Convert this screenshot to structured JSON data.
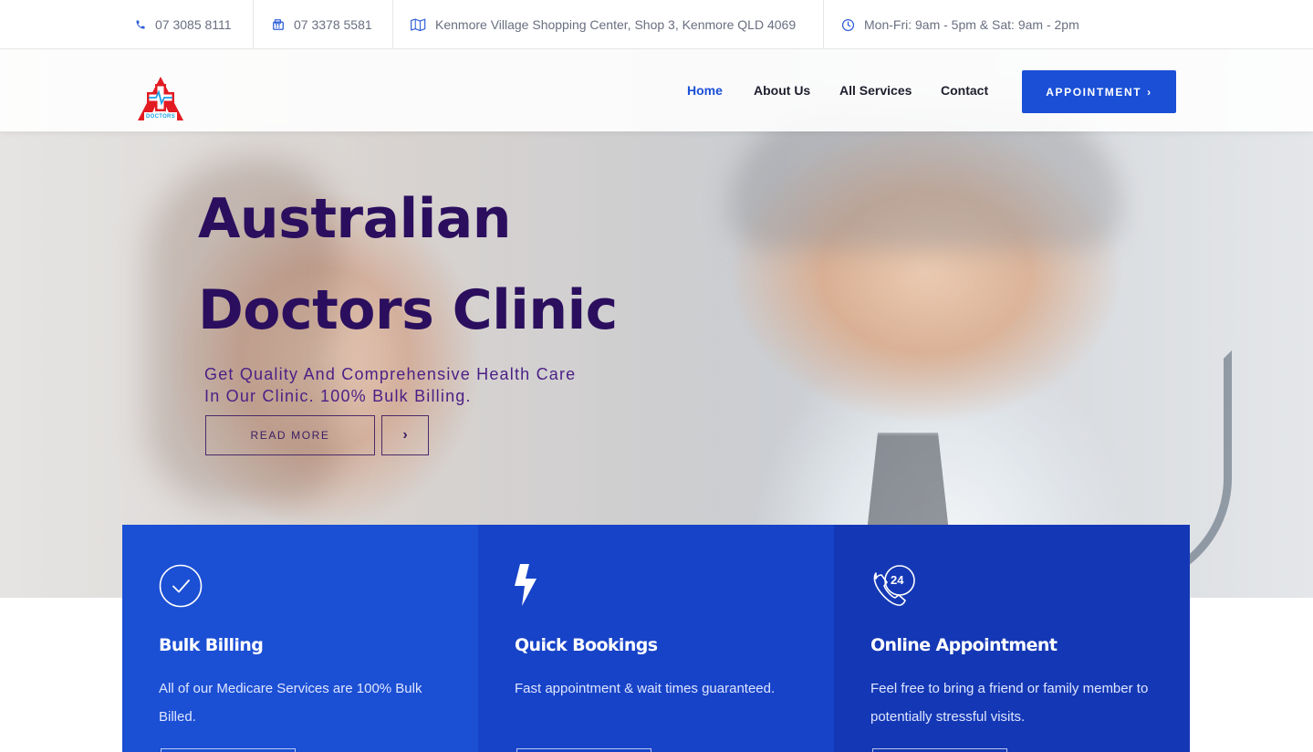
{
  "topbar": {
    "phone": "07 3085 8111",
    "fax": "07 3378 5581",
    "address": "Kenmore Village Shopping Center, Shop 3, Kenmore QLD 4069",
    "hours": "Mon-Fri: 9am - 5pm & Sat: 9am - 2pm"
  },
  "header": {
    "logo_text": "DOCTORS",
    "nav": [
      "Home",
      "About Us",
      "All Services",
      "Contact"
    ],
    "appointment_button": "APPOINTMENT",
    "appointment_chevron": "›"
  },
  "hero": {
    "title_line1": "Australian",
    "title_line2": "Doctors Clinic",
    "subtitle": "Get Quality And Comprehensive Health Care In Our Clinic. 100% Bulk Billing.",
    "read_more": "READ MORE",
    "next_arrow": "›"
  },
  "cards": [
    {
      "title": "Bulk Billing",
      "text": "All of our Medicare Services are 100% Bulk Billed.",
      "icon": "check-circle-icon",
      "color": "#1b4fd4"
    },
    {
      "title": "Quick Bookings",
      "text": "Fast appointment & wait times guaranteed.",
      "icon": "lightning-icon",
      "color": "#1743c8"
    },
    {
      "title": "Online Appointment",
      "text": "Feel free to bring a friend or family member to potentially stressful visits.",
      "icon": "phone-24-icon",
      "badge": "24",
      "color": "#1438b5"
    }
  ],
  "colors": {
    "brand_blue": "#1a4fd6",
    "title_purple": "#2b0f5e",
    "text_gray": "#6a6f80"
  }
}
